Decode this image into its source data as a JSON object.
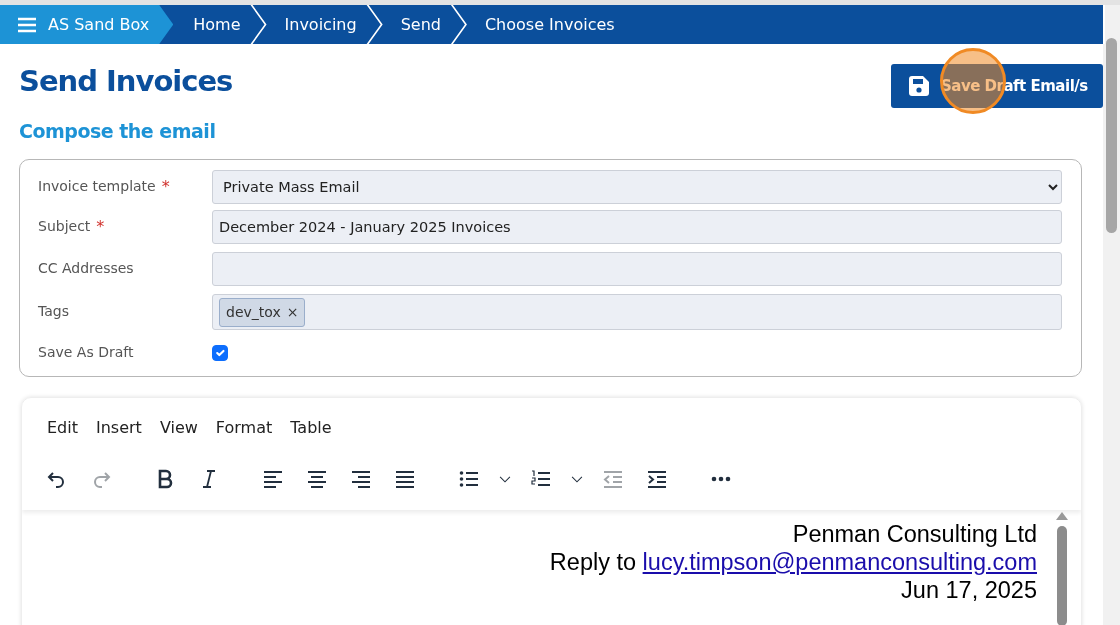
{
  "breadcrumb": [
    {
      "label": "AS Sand Box",
      "kind": "app"
    },
    {
      "label": "Home",
      "kind": "crumb"
    },
    {
      "label": "Invoicing",
      "kind": "crumb"
    },
    {
      "label": "Send",
      "kind": "crumb"
    },
    {
      "label": "Choose Invoices",
      "kind": "crumb"
    }
  ],
  "title": "Send Invoices",
  "save_button": {
    "label": "Save Draft Email/s",
    "click_highlight": true
  },
  "section_title": "Compose the email",
  "form": [
    {
      "kind": "select",
      "label": "Invoice template",
      "required_mark": "*",
      "value": "Private Mass Email"
    },
    {
      "kind": "text",
      "label": "Subject",
      "required_mark": "*",
      "value": "December 2024 - January 2025 Invoices"
    },
    {
      "kind": "text",
      "label": "CC Addresses"
    },
    {
      "kind": "tags",
      "label": "Tags",
      "tags": [
        {
          "label": "dev_tox",
          "remove": "×"
        }
      ]
    },
    {
      "kind": "checkbox",
      "label": "Save As Draft",
      "checked": true
    }
  ],
  "editor": {
    "menu": [
      "Edit",
      "Insert",
      "View",
      "Format",
      "Table"
    ],
    "toolbar": [
      {
        "tools": [
          {
            "kind": "undo",
            "disabled": false
          },
          {
            "kind": "redo",
            "disabled": true
          }
        ]
      },
      {
        "tools": [
          {
            "kind": "bold",
            "disabled": false
          },
          {
            "kind": "italic",
            "disabled": false
          }
        ]
      },
      {
        "tools": [
          {
            "kind": "align-left",
            "disabled": false
          },
          {
            "kind": "align-center",
            "disabled": false
          },
          {
            "kind": "align-right",
            "disabled": false
          },
          {
            "kind": "justify",
            "disabled": false
          }
        ]
      },
      {
        "tools": [
          {
            "kind": "bullet-list",
            "disabled": false
          },
          {
            "kind": "caret",
            "disabled": false
          },
          {
            "kind": "numbered-list",
            "disabled": false
          },
          {
            "kind": "caret",
            "disabled": false
          },
          {
            "kind": "outdent",
            "disabled": true
          },
          {
            "kind": "indent",
            "disabled": false
          }
        ]
      },
      {
        "tools": [
          {
            "kind": "more",
            "disabled": false
          }
        ]
      }
    ],
    "content": {
      "company": "Penman Consulting Ltd",
      "reply_prefix": "Reply to",
      "email": "lucy.timpson@penmanconsulting.com",
      "date": "Jun 17, 2025"
    }
  }
}
